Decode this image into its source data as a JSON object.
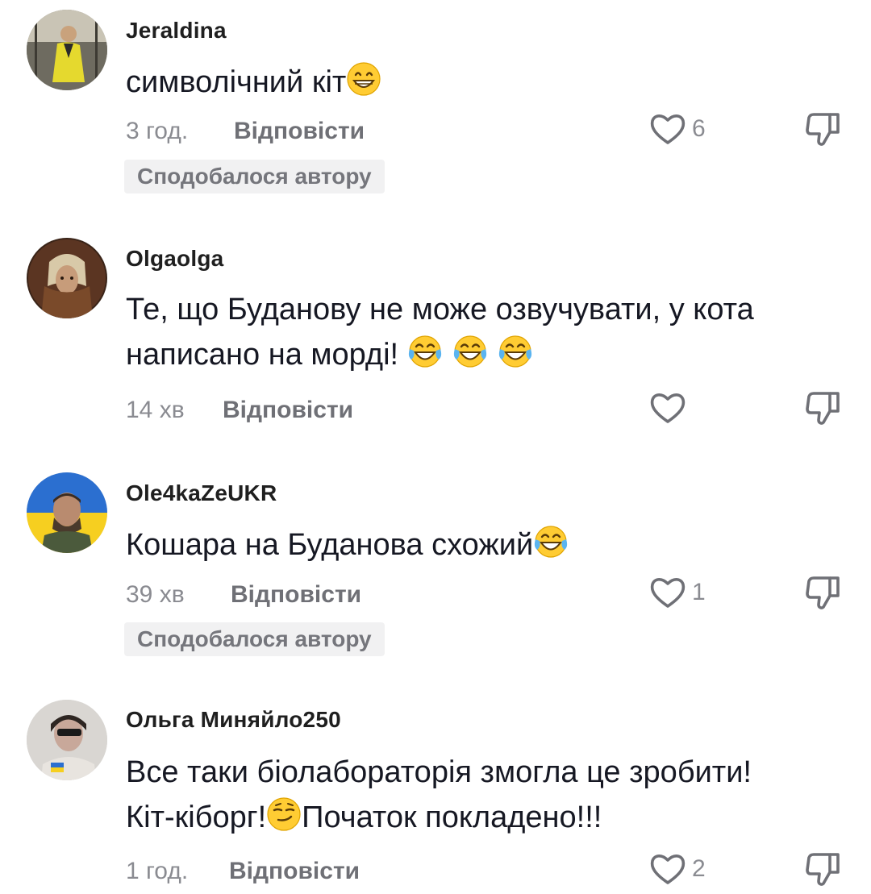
{
  "comments": [
    {
      "username": "Jeraldina",
      "text_parts": [
        "символічний кіт"
      ],
      "time": "3 год.",
      "reply_label": "Відповісти",
      "like_count": "6",
      "creator_badge": "Сподобалося автору"
    },
    {
      "username": "Olgaolga",
      "text_line1": "Те, що Буданову не може озвучувати, у кота",
      "text_line2": "написано на морді! ",
      "time": "14 хв",
      "reply_label": "Відповісти",
      "like_count": ""
    },
    {
      "username": "Ole4kaZeUKR",
      "text_parts": [
        "Кошара на Буданова схожий"
      ],
      "time": "39 хв",
      "reply_label": "Відповісти",
      "like_count": "1",
      "creator_badge": "Сподобалося автору"
    },
    {
      "username": "Ольга Миняйло250",
      "text_line1": "Все таки біолабораторія змогла це зробити!",
      "text_line2a": "Кіт-кіборг!",
      "text_line2b": "Початок покладено!!!",
      "time": "1 год.",
      "reply_label": "Відповісти",
      "like_count": "2"
    }
  ],
  "icons": {
    "like": "heart-outline-icon",
    "dislike": "thumbs-down-outline-icon",
    "emoji_grin": "grinning-face-with-smiling-eyes",
    "emoji_tears": "face-with-tears-of-joy",
    "emoji_smirk": "smirking-face"
  },
  "colors": {
    "text": "#161823",
    "meta": "#8a8b91",
    "badge_bg": "#f1f1f2"
  }
}
